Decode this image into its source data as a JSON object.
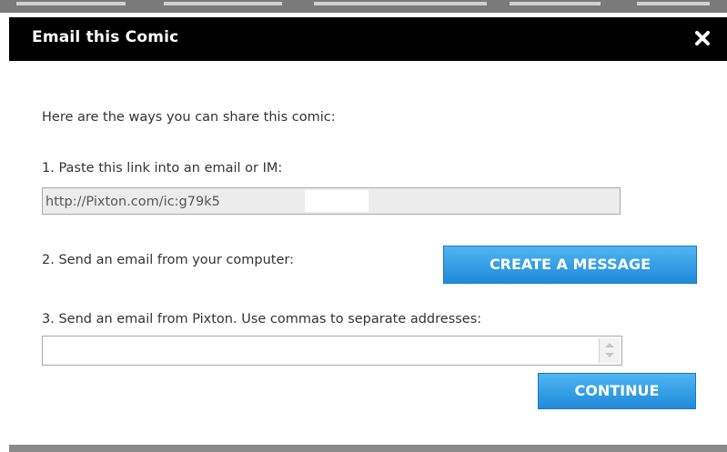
{
  "dialog": {
    "title": "Email this Comic",
    "intro": "Here are the ways you can share this comic:",
    "step1_label": "1. Paste this link into an email or IM:",
    "link_value": "http://Pixton.com/ic:g79k5",
    "step2_label": "2. Send an email from your computer:",
    "create_message_label": "CREATE A MESSAGE",
    "step3_label": "3. Send an email from Pixton. Use commas to separate addresses:",
    "email_value": "",
    "continue_label": "CONTINUE"
  },
  "icons": {
    "close": "close-icon",
    "spinner_up": "chevron-up-icon",
    "spinner_down": "chevron-down-icon"
  },
  "colors": {
    "title_bar": "#000000",
    "button_top": "#4fb6f2",
    "button_bottom": "#1f8ad9",
    "text": "#333333",
    "link_field_bg": "#ececec"
  }
}
